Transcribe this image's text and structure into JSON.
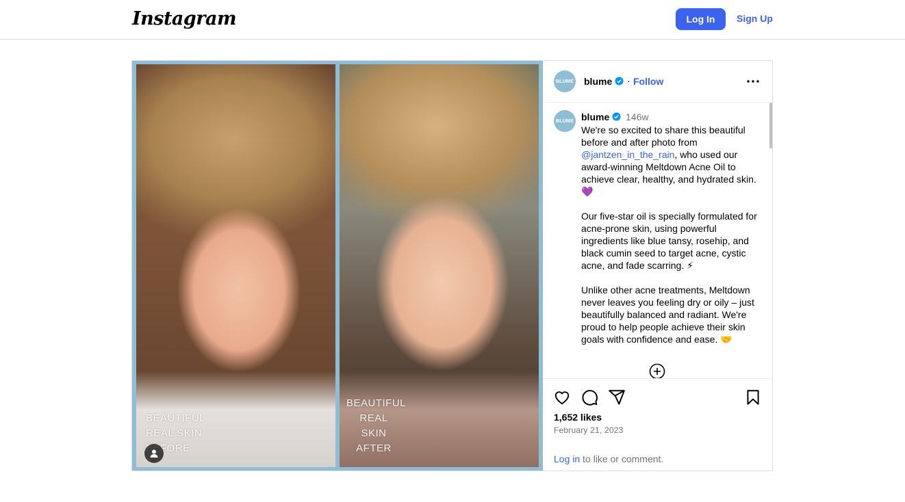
{
  "header": {
    "logo_text": "Instagram",
    "login_label": "Log In",
    "signup_label": "Sign Up"
  },
  "media": {
    "before_caption": "BEAUTIFUL\nREAL SKIN\nBEFORE",
    "after_caption": "BEAUTIFUL\nREAL SKIN\nAFTER"
  },
  "post_header": {
    "avatar_text": "BLUME",
    "username": "blume",
    "separator": "·",
    "follow_label": "Follow"
  },
  "caption": {
    "username": "blume",
    "time": "146w",
    "para1_before_mention": "We're so excited to share this beautiful before and after photo from ",
    "mention": "@jantzen_in_the_rain",
    "para1_after_mention": ", who used our award-winning Meltdown Acne Oil to achieve clear, healthy, and hydrated skin. 💜",
    "para2": "Our five-star oil is specially formulated for acne-prone skin, using powerful ingredients like blue tansy, rosehip, and black cumin seed to target acne, cystic acne, and fade scarring. ⚡",
    "para3": "Unlike other acne treatments, Meltdown never leaves you feeling dry or oily – just beautifully balanced and radiant. We're proud to help people achieve their skin goals with confidence and ease. 🤝"
  },
  "actions": {
    "likes": "1,652 likes",
    "date": "February 21, 2023",
    "login_link": "Log in",
    "login_suffix": " to like or comment."
  },
  "colors": {
    "accent": "#3a63f0",
    "media_frame": "#8fbdd6",
    "muted_text": "#737373",
    "verified": "#0095f6"
  },
  "icons": [
    "user-tag-icon",
    "verified-icon",
    "more-options-icon",
    "load-more-icon",
    "heart-icon",
    "comment-icon",
    "share-icon",
    "bookmark-icon"
  ]
}
